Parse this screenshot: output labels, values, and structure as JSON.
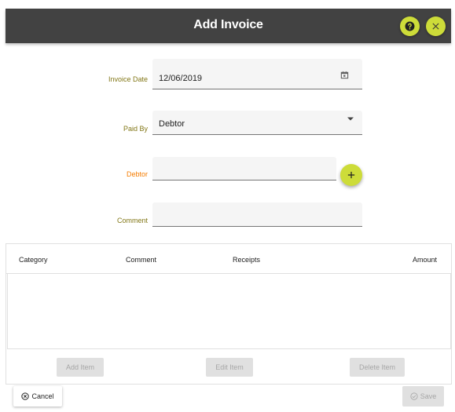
{
  "dialog": {
    "title": "Add Invoice",
    "help_icon": "help-circle-icon",
    "close_icon": "close-icon"
  },
  "form": {
    "invoice_date": {
      "label": "Invoice Date",
      "value": "12/06/2019",
      "icon": "calendar-icon"
    },
    "paid_by": {
      "label": "Paid By",
      "value": "Debtor",
      "icon": "dropdown-arrow-icon"
    },
    "debtor": {
      "label": "Debtor",
      "value": "",
      "required": true,
      "add_icon": "plus-icon"
    },
    "comment": {
      "label": "Comment",
      "value": ""
    }
  },
  "items_table": {
    "columns": [
      "Category",
      "Comment",
      "Receipts",
      "Amount"
    ],
    "rows": [],
    "buttons": {
      "add": "Add Item",
      "edit": "Edit Item",
      "delete": "Delete Item"
    }
  },
  "footer": {
    "cancel_label": "Cancel",
    "save_label": "Save"
  },
  "colors": {
    "header_bg": "#424242",
    "accent": "#cddc39",
    "label": "#827717",
    "required_label": "#f57c00",
    "disabled_bg": "#e0e0e0",
    "disabled_text": "#a6a6a6"
  }
}
